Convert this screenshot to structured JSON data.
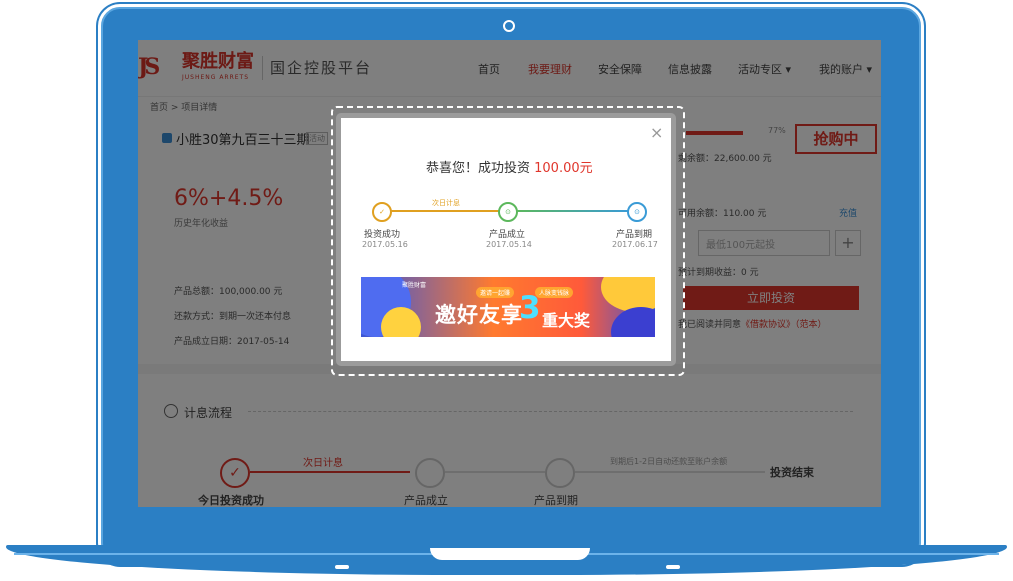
{
  "header": {
    "logo_mark": "JS",
    "logo_name": "聚胜财富",
    "logo_sub": "JUSHENG ARRETS",
    "slogan": "国企控股平台",
    "nav": [
      {
        "label": "首页"
      },
      {
        "label": "我要理财"
      },
      {
        "label": "安全保障"
      },
      {
        "label": "信息披露"
      },
      {
        "label": "活动专区 ▾"
      },
      {
        "label": "我的账户 ▾"
      }
    ]
  },
  "breadcrumb": "首页 > 项目详情",
  "product": {
    "title": "小胜30第九百三十三期",
    "tag": "活动",
    "rate": "6%+4.5%",
    "rate_label": "历史年化收益",
    "total": "产品总额：100,000.00 元",
    "repay": "还款方式：到期一次还本付息",
    "date": "产品成立日期：2017-05-14"
  },
  "side": {
    "progress_pct": "77%",
    "stamp": "抢购中",
    "remaining": "剩余额：22,600.00 元",
    "balance": "可用余额：110.00 元",
    "recharge": "充值",
    "amount_placeholder": "最低100元起投",
    "expected": "预计到期收益：0 元",
    "invest_button": "立即投资",
    "agree_prefix": "我已阅读并同意",
    "agree_link": "《借款协议》（范本）"
  },
  "flow": {
    "title": "计息流程",
    "next_day": "次日计息",
    "note": "到期后1-2日自动还款至账户余额",
    "steps": [
      "今日投资成功",
      "产品成立",
      "产品到期",
      "投资结束"
    ]
  },
  "modal": {
    "close": "×",
    "congrats": "恭喜您！成功投资 ",
    "amount": "100.00元",
    "next_day": "次日计息",
    "steps": [
      {
        "label": "投资成功",
        "date": "2017.05.16",
        "icon": "✓"
      },
      {
        "label": "产品成立",
        "date": "2017.05.14",
        "icon": "⊙"
      },
      {
        "label": "产品到期",
        "date": "2017.06.17",
        "icon": "⊙"
      }
    ],
    "banner": {
      "logo": "聚胜财富",
      "tag1": "邀请一起赚",
      "tag2": "人脉变钱脉",
      "title_a": "邀好友享",
      "title_three": "3",
      "title_b": "重大奖"
    }
  },
  "colors": {
    "brand_red": "#d9342b",
    "laptop_blue": "#2b7fc4",
    "step_gold": "#e0a020",
    "step_green": "#5cb85c",
    "step_blue": "#3a9bd6"
  }
}
